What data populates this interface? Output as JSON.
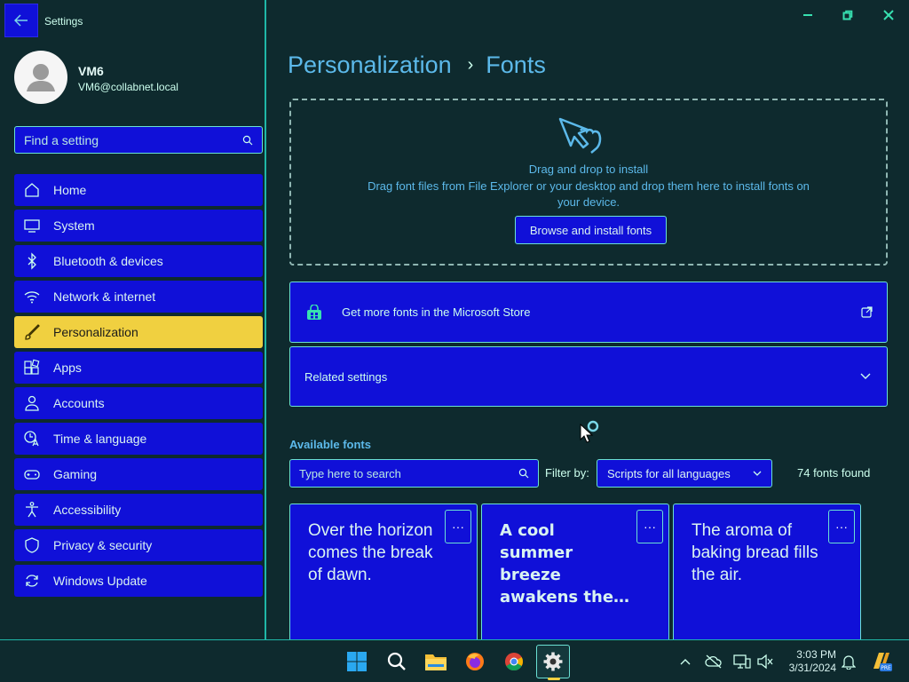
{
  "window": {
    "title": "Settings"
  },
  "user": {
    "name": "VM6",
    "email": "VM6@collabnet.local"
  },
  "search": {
    "placeholder": "Find a setting"
  },
  "nav": [
    {
      "label": "Home",
      "icon": "home-icon"
    },
    {
      "label": "System",
      "icon": "monitor-icon"
    },
    {
      "label": "Bluetooth & devices",
      "icon": "bluetooth-icon"
    },
    {
      "label": "Network & internet",
      "icon": "wifi-icon"
    },
    {
      "label": "Personalization",
      "icon": "brush-icon",
      "active": true
    },
    {
      "label": "Apps",
      "icon": "apps-icon"
    },
    {
      "label": "Accounts",
      "icon": "person-icon"
    },
    {
      "label": "Time & language",
      "icon": "clock-language-icon"
    },
    {
      "label": "Gaming",
      "icon": "gamepad-icon"
    },
    {
      "label": "Accessibility",
      "icon": "accessibility-icon"
    },
    {
      "label": "Privacy & security",
      "icon": "shield-icon"
    },
    {
      "label": "Windows Update",
      "icon": "update-icon"
    }
  ],
  "breadcrumb": {
    "parent": "Personalization",
    "separator": "›",
    "current": "Fonts"
  },
  "dropzone": {
    "title": "Drag and drop to install",
    "description": "Drag font files from File Explorer or your desktop and drop them here to install fonts on your device.",
    "button": "Browse and install fonts"
  },
  "store": {
    "label": "Get more fonts in the Microsoft Store"
  },
  "related": {
    "label": "Related settings"
  },
  "fonts": {
    "heading": "Available fonts",
    "search_placeholder": "Type here to search",
    "filter_label": "Filter by:",
    "filter_value": "Scripts for all languages",
    "count": "74 fonts found",
    "cards": [
      {
        "preview": "Over the horizon comes the break of dawn.",
        "more": "···"
      },
      {
        "preview": "A cool summer breeze awakens the…",
        "more": "···"
      },
      {
        "preview": "The aroma of baking bread fills the air.",
        "more": "···"
      }
    ]
  },
  "taskbar": {
    "time": "3:03 PM",
    "date": "3/31/2024"
  },
  "colors": {
    "accent_fill": "#1010d8",
    "border": "#6be0d4",
    "active_nav": "#f0d040",
    "heading": "#5cb9ea",
    "background": "#0e2a2e"
  }
}
